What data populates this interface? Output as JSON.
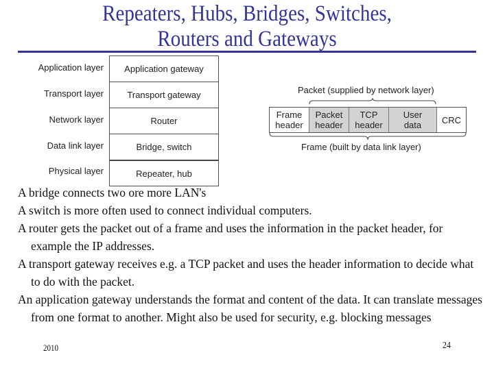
{
  "slide": {
    "title_line1": "Repeaters, Hubs, Bridges, Switches,",
    "title_line2": "Routers and Gateways",
    "colors": {
      "title": "#333399",
      "rule": "#333399",
      "packet_fill": "#d3d3d3"
    }
  },
  "layer_diagram": {
    "rows": [
      {
        "layer": "Application layer",
        "device": "Application gateway"
      },
      {
        "layer": "Transport layer",
        "device": "Transport gateway"
      },
      {
        "layer": "Network layer",
        "device": "Router"
      },
      {
        "layer": "Data link layer",
        "device": "Bridge, switch"
      },
      {
        "layer": "Physical layer",
        "device": "Repeater, hub"
      }
    ]
  },
  "frame_diagram": {
    "packet_label": "Packet (supplied by network layer)",
    "frame_label": "Frame (built by data link layer)",
    "cells": [
      {
        "line1": "Frame",
        "line2": "header",
        "shaded": false
      },
      {
        "line1": "Packet",
        "line2": "header",
        "shaded": true
      },
      {
        "line1": "TCP",
        "line2": "header",
        "shaded": true
      },
      {
        "line1": "User",
        "line2": "data",
        "shaded": true
      },
      {
        "line1": "CRC",
        "line2": "",
        "shaded": false
      }
    ]
  },
  "body": {
    "paragraphs": [
      "A bridge connects two ore more LAN's",
      "A switch is more often used to connect individual computers.",
      "A router gets the packet out of a frame and uses the information in the packet header, for example the IP addresses.",
      "A transport gateway receives e.g. a TCP packet and uses the header information to decide what to do with the packet.",
      "An application gateway understands the format and content of the data. It can translate messages from one format to another. Might also be used for security, e.g. blocking messages"
    ]
  },
  "footer": {
    "year": "2010",
    "page_number": "24"
  }
}
